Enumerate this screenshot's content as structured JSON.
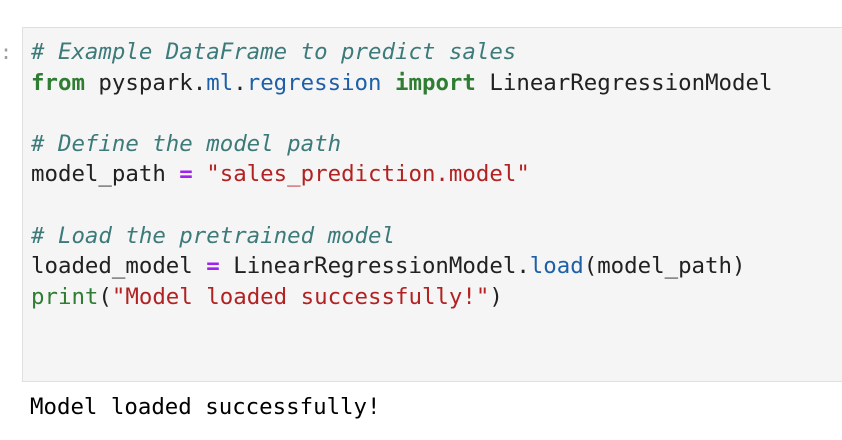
{
  "cell": {
    "prompt": ":",
    "lines": {
      "l1": {
        "comment": "# Example DataFrame to predict sales"
      },
      "l2": {
        "kw_from": "from",
        "mod_a": "pyspark",
        "dot1": ".",
        "mod_b": "ml",
        "dot2": ".",
        "mod_c": "regression",
        "kw_import": "import",
        "name": "LinearRegressionModel"
      },
      "l4": {
        "comment": "# Define the model path"
      },
      "l5": {
        "var": "model_path",
        "op": "=",
        "value": "\"sales_prediction.model\""
      },
      "l7": {
        "comment": "# Load the pretrained model"
      },
      "l8": {
        "var": "loaded_model",
        "op": "=",
        "cls": "LinearRegressionModel",
        "dot": ".",
        "method": "load",
        "args": "(model_path)"
      },
      "l9": {
        "fn": "print",
        "open": "(",
        "arg": "\"Model loaded successfully!\"",
        "close": ")"
      }
    }
  },
  "output": {
    "text": "Model loaded successfully!"
  }
}
